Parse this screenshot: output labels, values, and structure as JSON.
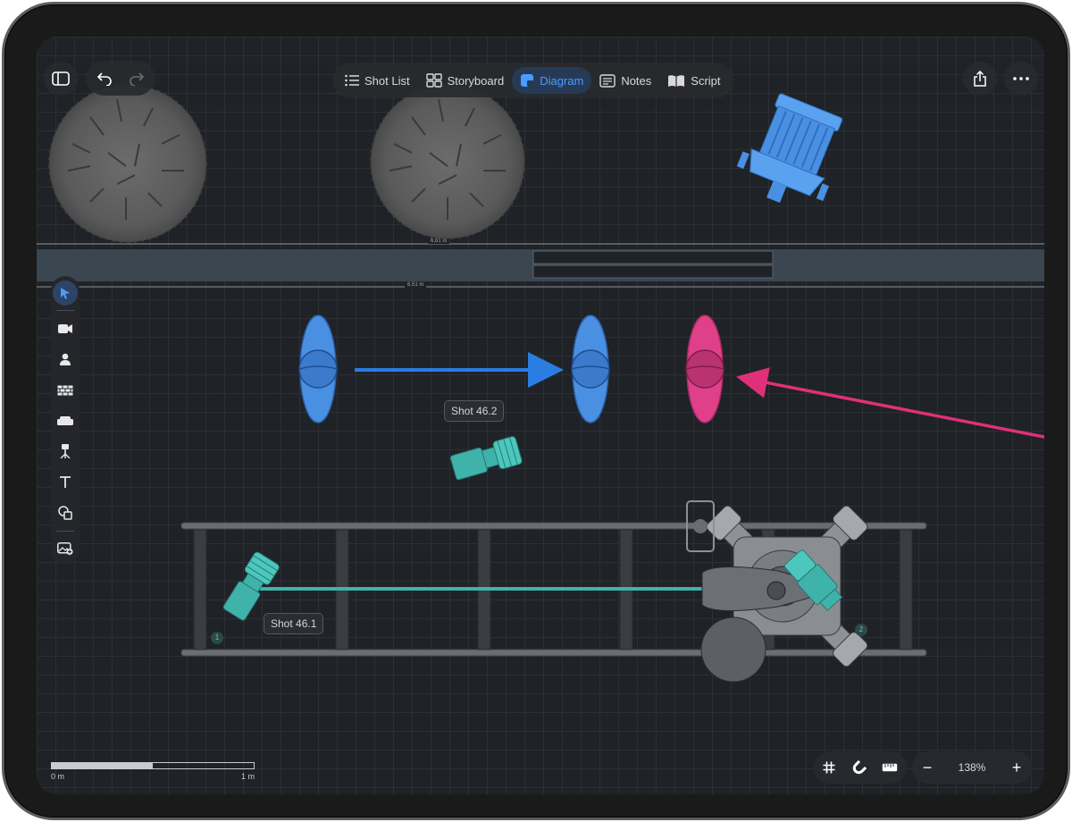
{
  "nav": {
    "tabs": [
      {
        "label": "Shot List",
        "icon": "list-icon"
      },
      {
        "label": "Storyboard",
        "icon": "storyboard-grid-icon"
      },
      {
        "label": "Diagram",
        "icon": "diagram-icon",
        "active": true
      },
      {
        "label": "Notes",
        "icon": "notes-icon"
      },
      {
        "label": "Script",
        "icon": "book-icon"
      }
    ]
  },
  "toolbar": {
    "tools": [
      "select-arrow-icon",
      "camera-icon",
      "person-icon",
      "wall-icon",
      "sofa-icon",
      "light-stand-icon",
      "text-icon",
      "shapes-icon",
      "add-image-icon"
    ]
  },
  "canvas": {
    "dimension_top": "6,61 m",
    "dimension_bottom": "6,51 m",
    "shot_a": "Shot 46.2",
    "shot_b": "Shot 46.1",
    "badge_one": "1",
    "badge_two": "2"
  },
  "scale_bar": {
    "start": "0 m",
    "end": "1 m"
  },
  "zoom": {
    "value": "138%",
    "minus": "−",
    "plus": "+"
  },
  "colors": {
    "actor_blue": "#4a90e2",
    "actor_pink": "#e0408a",
    "camera_teal": "#3fb3aa",
    "arrow_blue": "#2a7de1",
    "arrow_pink": "#e0307a",
    "accent": "#4a9cff"
  }
}
